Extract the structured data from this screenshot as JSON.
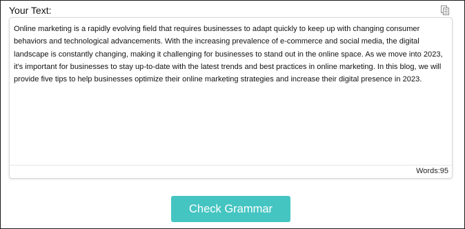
{
  "editor": {
    "label": "Your Text:",
    "text": "Online marketing is a rapidly evolving field that requires businesses to adapt quickly to keep up with changing consumer behaviors and technological advancements. With the increasing prevalence of e-commerce and social media, the digital landscape is constantly changing, making it challenging for businesses to stand out in the online space. As we move into 2023, it's important for businesses to stay up-to-date with the latest trends and best practices in online marketing. In this blog, we will provide five tips to help businesses optimize their online marketing strategies and increase their digital presence in 2023.",
    "word_count": "Words:95",
    "copy_icon": "copy-icon"
  },
  "actions": {
    "check_label": "Check Grammar"
  },
  "colors": {
    "button_bg": "#45c5c2",
    "button_text": "#ffffff",
    "frame_border": "#1a1a1a"
  }
}
